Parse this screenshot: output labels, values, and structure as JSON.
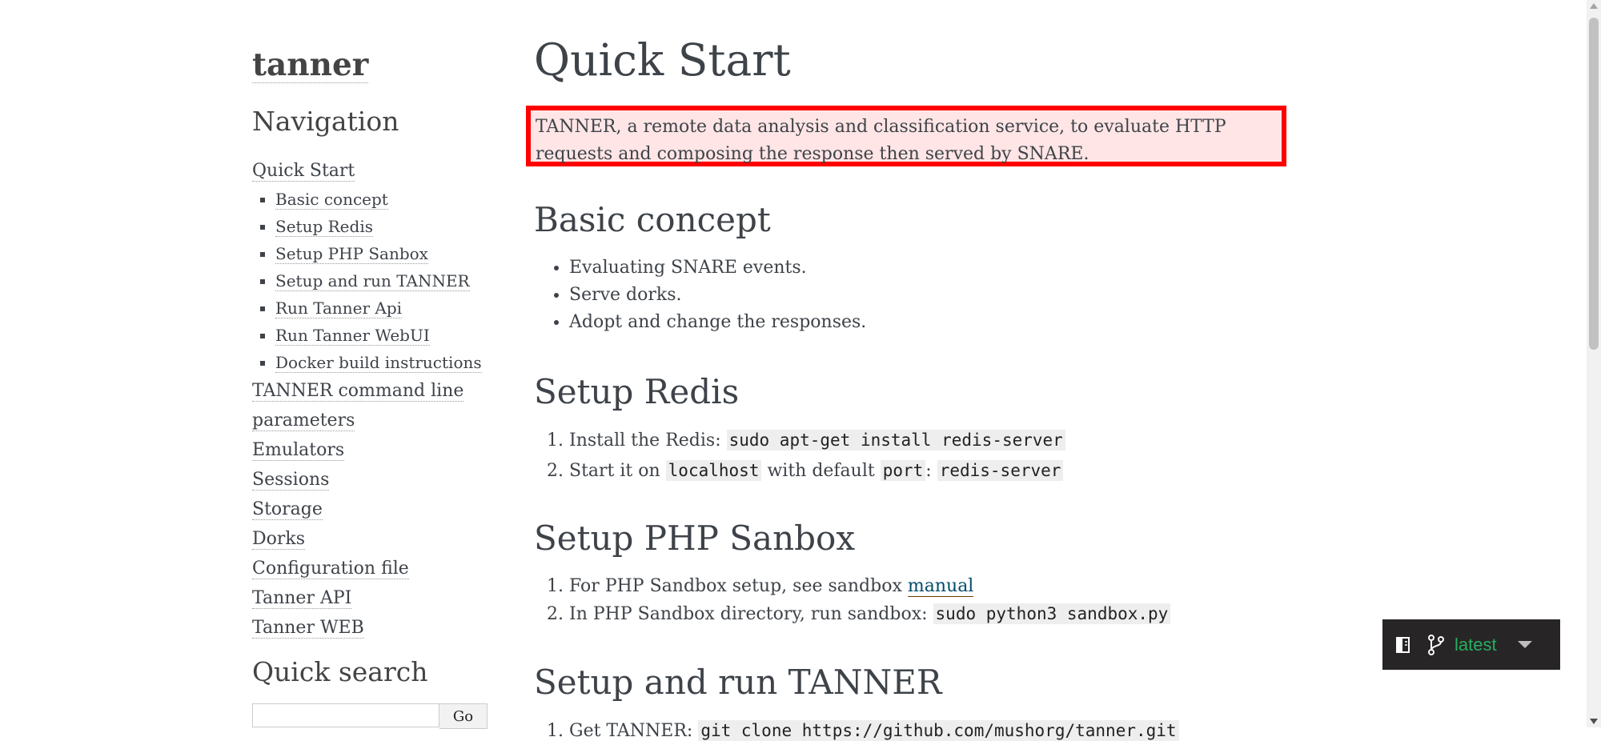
{
  "sidebar": {
    "logo_title": "tanner",
    "navigation_heading": "Navigation",
    "nav": [
      {
        "label": "Quick Start",
        "children": [
          "Basic concept",
          "Setup Redis",
          "Setup PHP Sanbox",
          "Setup and run TANNER",
          "Run Tanner Api",
          "Run Tanner WebUI",
          "Docker build instructions"
        ]
      },
      {
        "label_line1": "TANNER command line",
        "label_line2": "parameters"
      },
      {
        "label": "Emulators"
      },
      {
        "label": "Sessions"
      },
      {
        "label": "Storage"
      },
      {
        "label": "Dorks"
      },
      {
        "label": "Configuration file"
      },
      {
        "label": "Tanner API"
      },
      {
        "label": "Tanner WEB"
      }
    ],
    "quick_search_heading": "Quick search",
    "search_value": "",
    "go_label": "Go"
  },
  "main": {
    "title": "Quick Start",
    "intro": "TANNER, a remote data analysis and classification service, to evaluate HTTP requests and composing the response then served by SNARE.",
    "basic_concept": {
      "heading": "Basic concept",
      "items": [
        "Evaluating SNARE events.",
        "Serve dorks.",
        "Adopt and change the responses."
      ]
    },
    "setup_redis": {
      "heading": "Setup Redis",
      "item1_text": "Install the Redis: ",
      "item1_code": "sudo apt-get install redis-server",
      "item2_text_a": "Start it on ",
      "item2_code_a": "localhost",
      "item2_text_b": " with default ",
      "item2_code_b": "port",
      "item2_text_c": ": ",
      "item2_code_c": "redis-server"
    },
    "setup_php": {
      "heading": "Setup PHP Sanbox",
      "item1_text": "For PHP Sandbox setup, see sandbox ",
      "item1_link": "manual",
      "item2_text": "In PHP Sandbox directory, run sandbox: ",
      "item2_code": "sudo python3 sandbox.py"
    },
    "setup_run": {
      "heading": "Setup and run TANNER",
      "item1_text": "Get TANNER: ",
      "item1_code": "git clone https://github.com/mushorg/tanner.git"
    }
  },
  "versions_badge": {
    "book_icon": "book-icon",
    "branch_icon": "git-branch-icon",
    "label": "latest",
    "label_color": "#27ae60",
    "background": "#272525"
  },
  "highlight_color": "#ff0000"
}
